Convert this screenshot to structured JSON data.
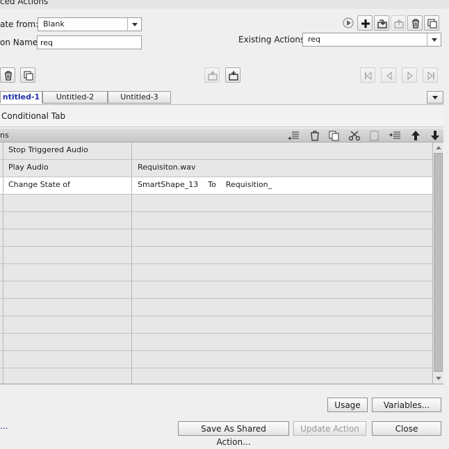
{
  "window": {
    "title": "ced Actions"
  },
  "form": {
    "create_from_label": "ate from:",
    "create_from_value": "Blank",
    "action_name_label": "on Name:",
    "action_name_value": "req",
    "existing_actions_label": "Existing Actions:",
    "existing_actions_value": "req"
  },
  "tabs": [
    {
      "label": "ntitled-1",
      "active": true
    },
    {
      "label": "Untitled-2",
      "active": false
    },
    {
      "label": "Untitled-3",
      "active": false
    }
  ],
  "conditional_tab_label": "Conditional Tab",
  "actions_header_label": "ns",
  "rows": [
    {
      "action": "Stop Triggered Audio",
      "target": "",
      "target_parts": []
    },
    {
      "action": "Play Audio",
      "target": "Requisiton.wav",
      "target_parts": []
    },
    {
      "action": "Change State of",
      "target": "",
      "target_parts": [
        "SmartShape_13",
        "To",
        "Requisition_"
      ]
    }
  ],
  "empty_row_count": 11,
  "buttons": {
    "usage": "Usage",
    "variables": "Variables...",
    "save_shared": "Save As Shared Action...",
    "update": "Update Action",
    "close": "Close"
  },
  "ellipsis": "...",
  "icons": {
    "top_right": [
      "play-icon",
      "add-icon",
      "import-icon",
      "export-icon",
      "delete-icon",
      "duplicate-icon"
    ],
    "row_tools": [
      "delete-icon",
      "duplicate-icon"
    ],
    "mid_tools": [
      "insert-before-icon",
      "insert-after-icon"
    ],
    "nav": [
      "first-icon",
      "previous-icon",
      "next-icon",
      "last-icon"
    ],
    "actions_header": [
      "add-row-icon",
      "delete-icon",
      "copy-icon",
      "cut-icon",
      "paste-icon",
      "insert-row-icon",
      "move-up-icon",
      "move-down-icon"
    ]
  },
  "colors": {
    "active_tab_text": "#1d2fa8",
    "selected_row": "#ffffff",
    "grid_bg": "#e7e7e7"
  }
}
